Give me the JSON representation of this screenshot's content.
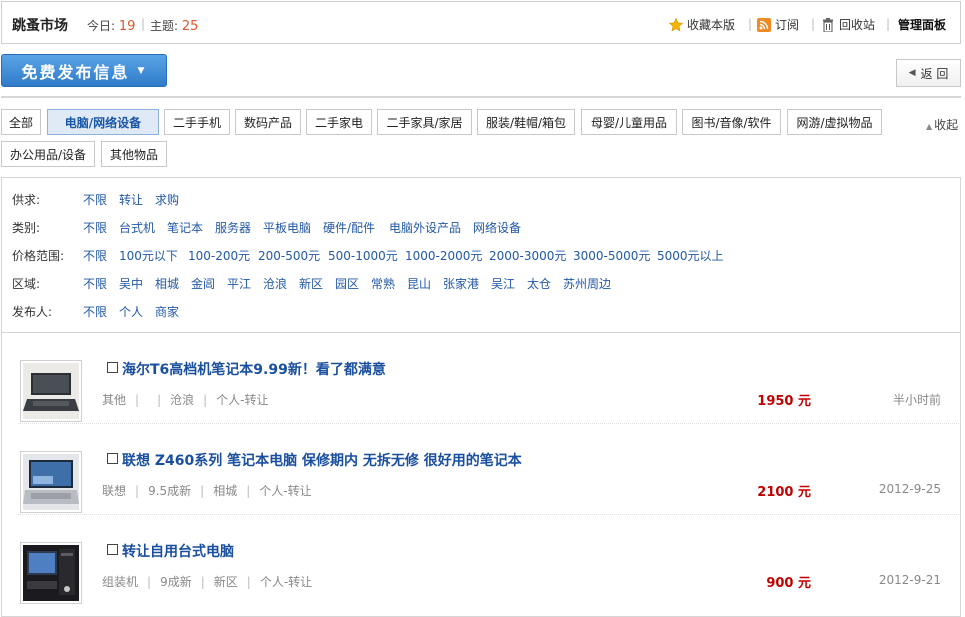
{
  "header": {
    "title": "跳蚤市场",
    "today_label": "今日:",
    "today_count": "19",
    "topics_label": "主题:",
    "topics_count": "25",
    "actions": {
      "favorite": "收藏本版",
      "subscribe": "订阅",
      "recycle": "回收站",
      "admin": "管理面板"
    }
  },
  "toolbar": {
    "post_label": "免费发布信息",
    "back_label": "返 回"
  },
  "categories": [
    "全部",
    "电脑/网络设备",
    "二手手机",
    "数码产品",
    "二手家电",
    "二手家具/家居",
    "服装/鞋帽/箱包",
    "母婴/儿童用品",
    "图书/音像/软件",
    "网游/虚拟物品",
    "办公用品/设备",
    "其他物品"
  ],
  "active_category": "电脑/网络设备",
  "collapse_label": "收起",
  "filters": {
    "supply": {
      "label": "供求:",
      "options": [
        "不限",
        "转让",
        "求购"
      ]
    },
    "type": {
      "label": "类别:",
      "options": [
        "不限",
        "台式机",
        "笔记本",
        "服务器",
        "平板电脑",
        "硬件/配件",
        "电脑外设产品",
        "网络设备"
      ]
    },
    "price": {
      "label": "价格范围:",
      "options": [
        "不限",
        "100元以下",
        "100-200元",
        "200-500元",
        "500-1000元",
        "1000-2000元",
        "2000-3000元",
        "3000-5000元",
        "5000元以上"
      ]
    },
    "region": {
      "label": "区域:",
      "options": [
        "不限",
        "吴中",
        "相城",
        "金阊",
        "平江",
        "沧浪",
        "新区",
        "园区",
        "常熟",
        "昆山",
        "张家港",
        "吴江",
        "太仓",
        "苏州周边"
      ]
    },
    "publisher": {
      "label": "发布人:",
      "options": [
        "不限",
        "个人",
        "商家"
      ]
    }
  },
  "listings": [
    {
      "title": "海尔T6高档机笔记本9.99新！看了都满意",
      "brand": "其他",
      "condition": "",
      "region": "沧浪",
      "seller": "个人-转让",
      "price": "1950 元",
      "time": "半小时前"
    },
    {
      "title": "联想 Z460系列 笔记本电脑 保修期内 无拆无修 很好用的笔记本",
      "brand": "联想",
      "condition": "9.5成新",
      "region": "相城",
      "seller": "个人-转让",
      "price": "2100 元",
      "time": "2012-9-25"
    },
    {
      "title": "转让自用台式电脑",
      "brand": "组装机",
      "condition": "9成新",
      "region": "新区",
      "seller": "个人-转让",
      "price": "900 元",
      "time": "2012-9-21"
    }
  ],
  "colors": {
    "accent_blue": "#2f7bc9",
    "link_blue": "#2358a6",
    "price_red": "#c20000",
    "count_orange": "#e0552b"
  }
}
